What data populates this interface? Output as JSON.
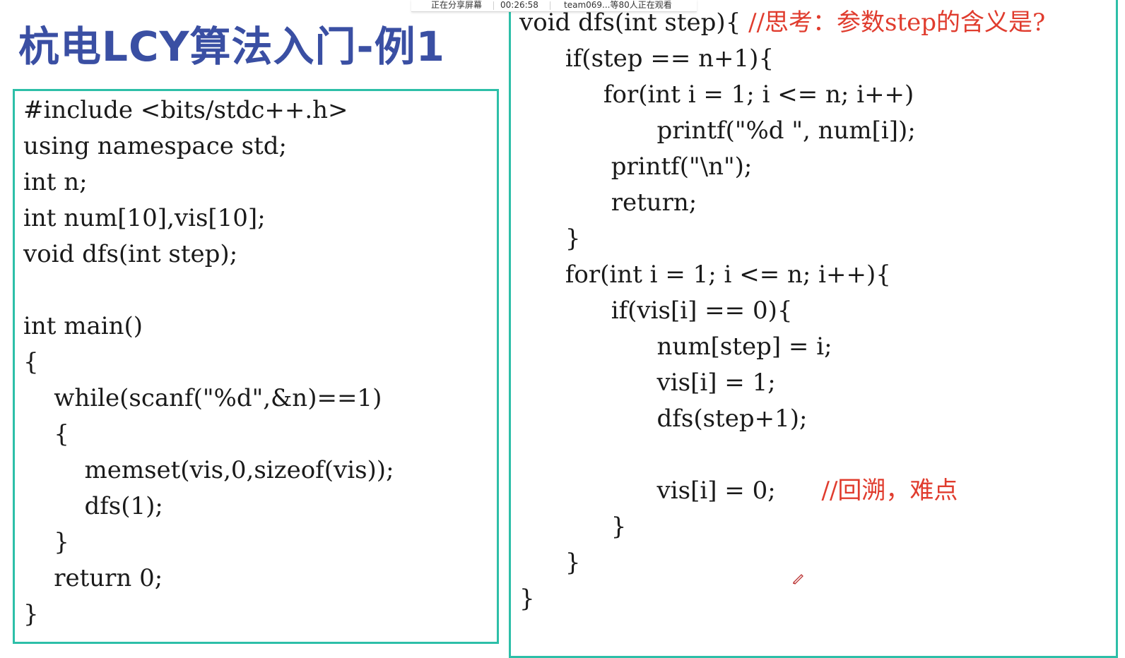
{
  "slide": {
    "title": "杭电LCY算法入门-例1"
  },
  "share_bar": {
    "status": "正在分享屏幕",
    "timer": "00:26:58",
    "viewers": "team069...等80人正在观看"
  },
  "left_code": [
    "#include <bits/stdc++.h>",
    "using namespace std;",
    "int n;",
    "int num[10],vis[10];",
    "void dfs(int step);",
    "",
    "int main()",
    "{",
    "    while(scanf(\"%d\",&n)==1)",
    "    {",
    "        memset(vis,0,sizeof(vis));",
    "        dfs(1);",
    "    }",
    "    return 0;",
    "}"
  ],
  "right_code": [
    {
      "code": "void dfs(int step){ ",
      "comment": "//思考：参数step的含义是?"
    },
    {
      "code": "      if(step == n+1){",
      "comment": ""
    },
    {
      "code": "           for(int i = 1; i <= n; i++)",
      "comment": ""
    },
    {
      "code": "                  printf(\"%d \", num[i]);",
      "comment": ""
    },
    {
      "code": "            printf(\"\\n\");",
      "comment": ""
    },
    {
      "code": "            return;",
      "comment": ""
    },
    {
      "code": "      }",
      "comment": ""
    },
    {
      "code": "      for(int i = 1; i <= n; i++){",
      "comment": ""
    },
    {
      "code": "            if(vis[i] == 0){",
      "comment": ""
    },
    {
      "code": "                  num[step] = i;",
      "comment": ""
    },
    {
      "code": "                  vis[i] = 1;",
      "comment": ""
    },
    {
      "code": "                  dfs(step+1);",
      "comment": ""
    },
    {
      "code": "",
      "comment": ""
    },
    {
      "code": "                  vis[i] = 0;      ",
      "comment": "//回溯，难点"
    },
    {
      "code": "            }",
      "comment": ""
    },
    {
      "code": "      }",
      "comment": ""
    },
    {
      "code": "}",
      "comment": ""
    }
  ],
  "colors": {
    "title": "#3a4fa3",
    "border": "#2dbfa8",
    "comment": "#e03c2e"
  }
}
